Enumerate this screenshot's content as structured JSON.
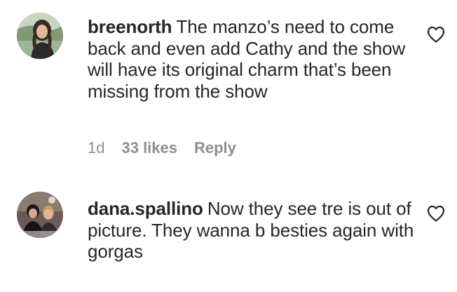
{
  "comments": [
    {
      "username": "breenorth",
      "text": "The manzo’s need to come back and even add Cathy and the show will have its original charm that’s been missing from the show",
      "time": "1d",
      "likes": "33 likes",
      "reply": "Reply",
      "avatar_icon": "profile-photo",
      "like_icon": "heart-outline-icon"
    },
    {
      "username": "dana.spallino",
      "text": "Now they see tre is out of picture. They wanna b besties again with gorgas",
      "avatar_icon": "profile-photo",
      "like_icon": "heart-outline-icon"
    }
  ],
  "colors": {
    "text": "#262626",
    "secondary": "#8e8e8e",
    "background": "#ffffff"
  }
}
